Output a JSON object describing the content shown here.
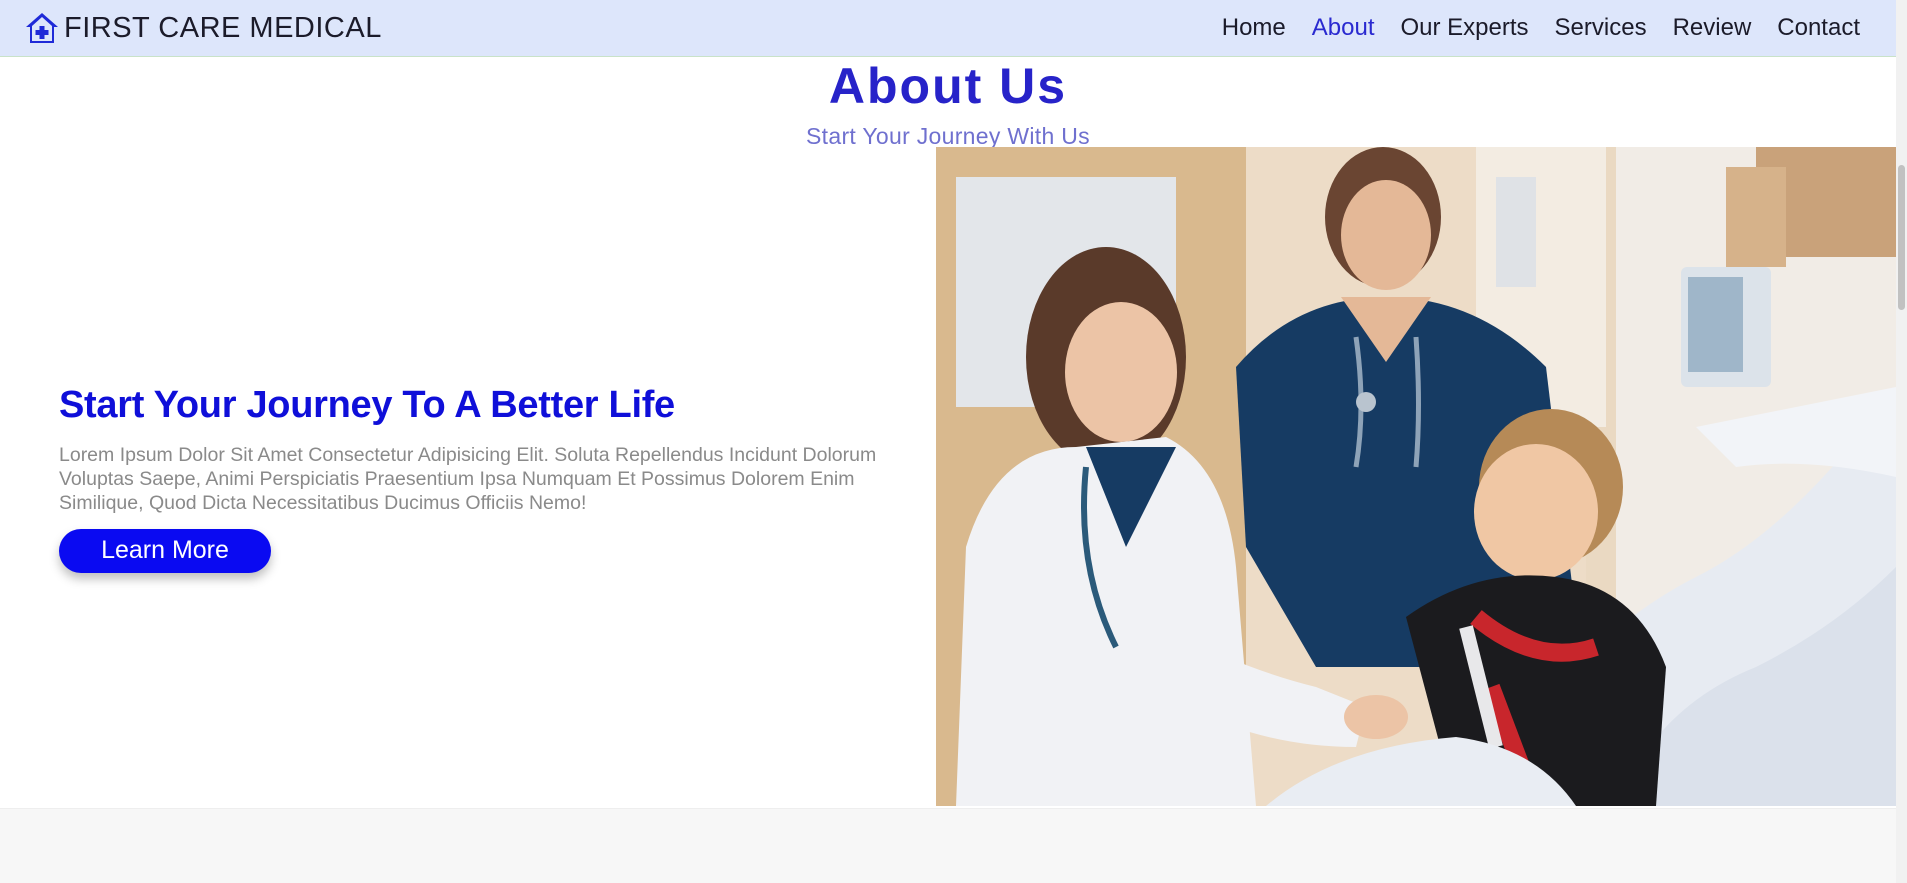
{
  "navbar": {
    "brand": "FIRST CARE MEDICAL",
    "brand_icon": "house-medical-icon",
    "links": [
      {
        "label": "Home",
        "active": false
      },
      {
        "label": "About",
        "active": true
      },
      {
        "label": "Our Experts",
        "active": false
      },
      {
        "label": "Services",
        "active": false
      },
      {
        "label": "Review",
        "active": false
      },
      {
        "label": "Contact",
        "active": false
      }
    ]
  },
  "section": {
    "title": "About Us",
    "subtitle": "Start Your Journey With Us"
  },
  "about": {
    "title": "Start Your Journey To A Better Life",
    "text": "Lorem Ipsum Dolor Sit Amet Consectetur Adipisicing Elit. Soluta Repellendus Incidunt Dolorum Voluptas Saepe, Animi Perspiciatis Praesentium Ipsa Numquam Et Possimus Dolorem Enim Similique, Quod Dicta Necessitatibus Ducimus Officiis Nemo!",
    "button_label": "Learn More"
  },
  "colors": {
    "navbar_bg": "#dde6fb",
    "accent": "#2723c9",
    "button": "#0a0af2"
  }
}
